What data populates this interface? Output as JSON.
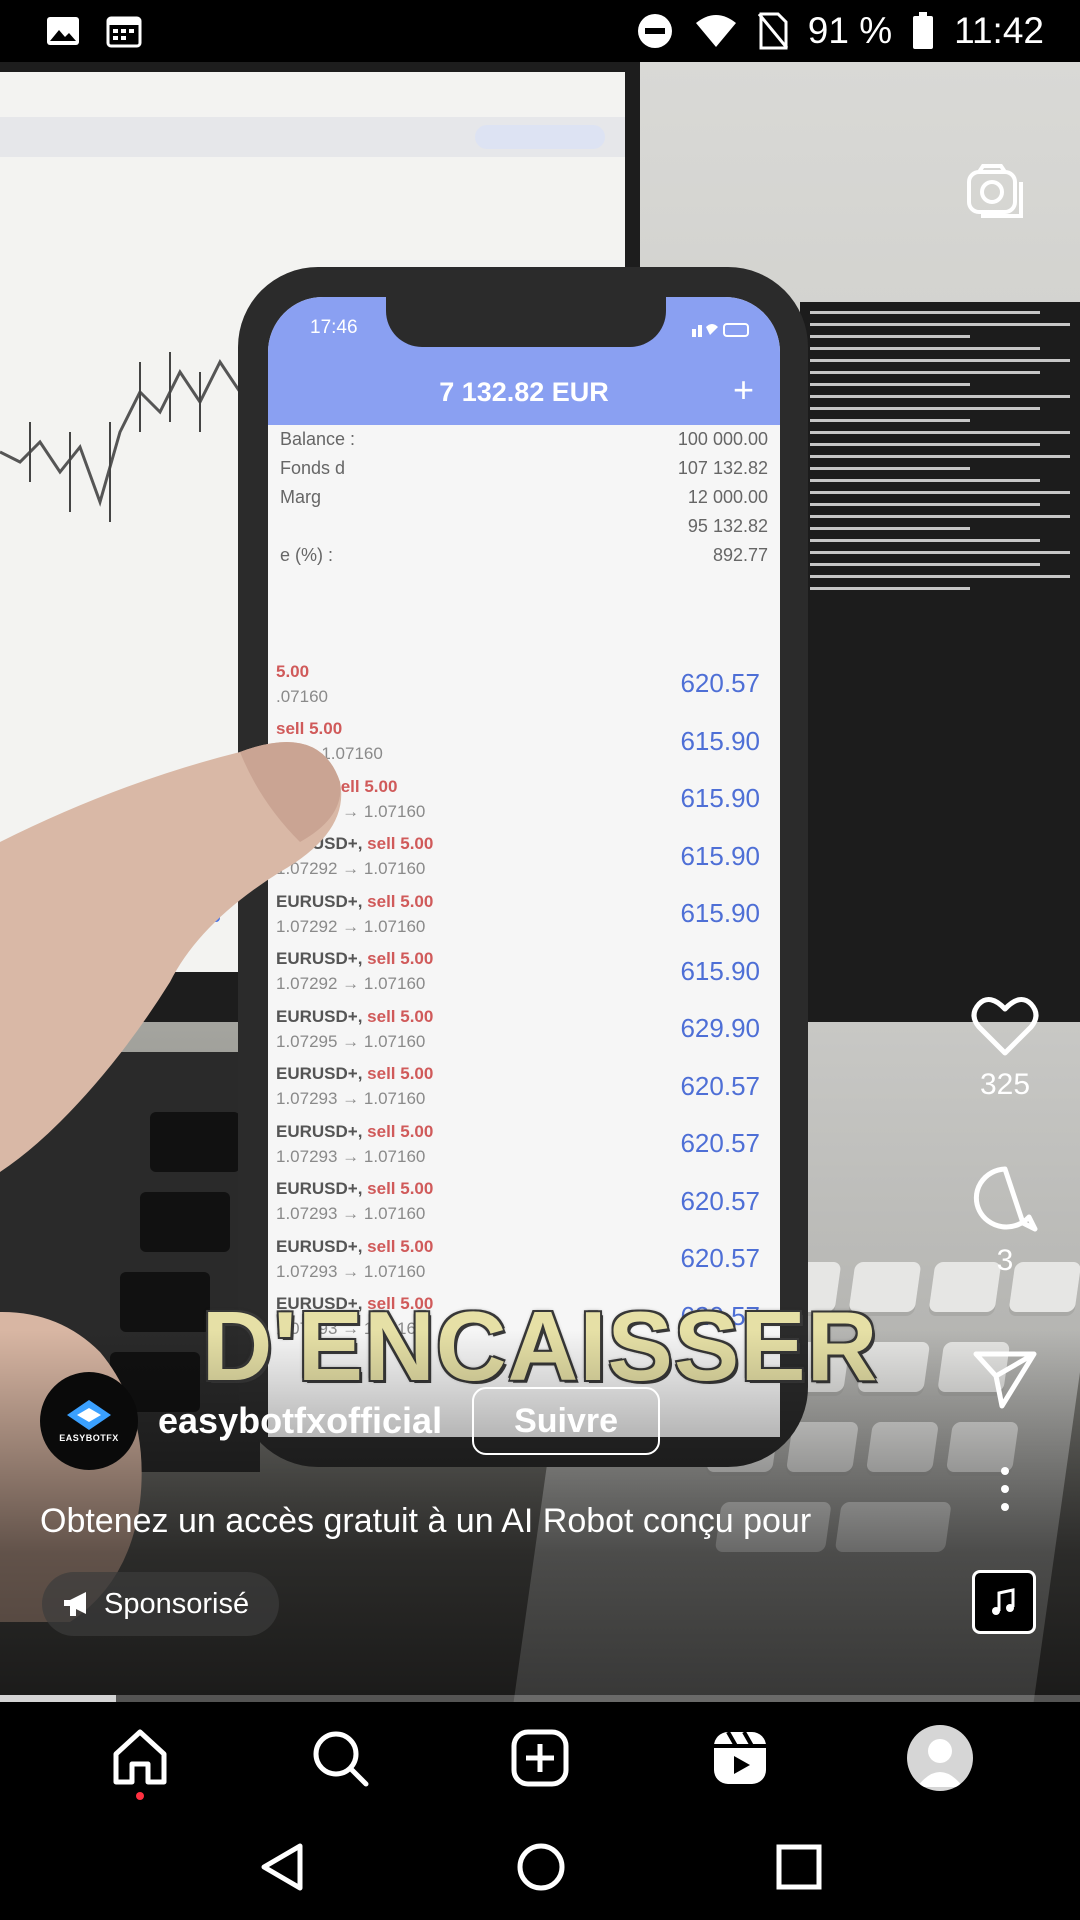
{
  "status_bar": {
    "battery": "91 %",
    "time": "11:42",
    "icons_left": [
      "image-icon",
      "calendar-icon"
    ],
    "icons_right": [
      "do-not-disturb-icon",
      "wifi-icon",
      "no-sim-icon",
      "battery-icon"
    ]
  },
  "video": {
    "caption": "D'ENCAISSER",
    "phone": {
      "time": "17:46",
      "balance": "7 132.82 EUR",
      "summary": [
        {
          "label": "Balance :",
          "value": "100 000.00"
        },
        {
          "label": "Fonds d",
          "value": "107 132.82"
        },
        {
          "label": "Marg",
          "value": "12 000.00"
        },
        {
          "label": "",
          "value": "95 132.82"
        },
        {
          "label": "e (%) :",
          "value": "892.77"
        }
      ],
      "trades": [
        {
          "symbol": "",
          "side": "5.00",
          "prices": ".07160",
          "profit": "620.57"
        },
        {
          "symbol": "",
          "side": "sell 5.00",
          "prices": "92 → 1.07160",
          "profit": "615.90"
        },
        {
          "symbol": "USD+,",
          "side": "sell 5.00",
          "prices": "1.07292 → 1.07160",
          "profit": "615.90"
        },
        {
          "symbol": "EURUSD+,",
          "side": "sell 5.00",
          "prices": "1.07292 → 1.07160",
          "profit": "615.90"
        },
        {
          "symbol": "EURUSD+,",
          "side": "sell 5.00",
          "prices": "1.07292 → 1.07160",
          "profit": "615.90"
        },
        {
          "symbol": "EURUSD+,",
          "side": "sell 5.00",
          "prices": "1.07292 → 1.07160",
          "profit": "615.90"
        },
        {
          "symbol": "EURUSD+,",
          "side": "sell 5.00",
          "prices": "1.07295 → 1.07160",
          "profit": "629.90"
        },
        {
          "symbol": "EURUSD+,",
          "side": "sell 5.00",
          "prices": "1.07293 → 1.07160",
          "profit": "620.57"
        },
        {
          "symbol": "EURUSD+,",
          "side": "sell 5.00",
          "prices": "1.07293 → 1.07160",
          "profit": "620.57"
        },
        {
          "symbol": "EURUSD+,",
          "side": "sell 5.00",
          "prices": "1.07293 → 1.07160",
          "profit": "620.57"
        },
        {
          "symbol": "EURUSD+,",
          "side": "sell 5.00",
          "prices": "1.07293 → 1.07160",
          "profit": "620.57"
        },
        {
          "symbol": "EURUSD+,",
          "side": "sell 5.00",
          "prices": "1.07293 → 1.07160",
          "profit": "620.57"
        }
      ]
    },
    "progress": 0.107
  },
  "actions": {
    "likes": "325",
    "comments": "3"
  },
  "post": {
    "avatar_text": "EASYBOTFX",
    "username": "easybotfxofficial",
    "follow_label": "Suivre",
    "description": "Obtenez un accès gratuit à un AI Robot conçu pour",
    "sponsored_label": "Sponsorisé"
  },
  "bottom_nav": [
    "home-icon",
    "search-icon",
    "create-icon",
    "reels-icon",
    "profile-avatar"
  ],
  "colors": {
    "phone_header": "#8aa0f2",
    "profit": "#4e6fd6",
    "caption": "#e6e0a6",
    "notification_dot": "#ff3040"
  }
}
